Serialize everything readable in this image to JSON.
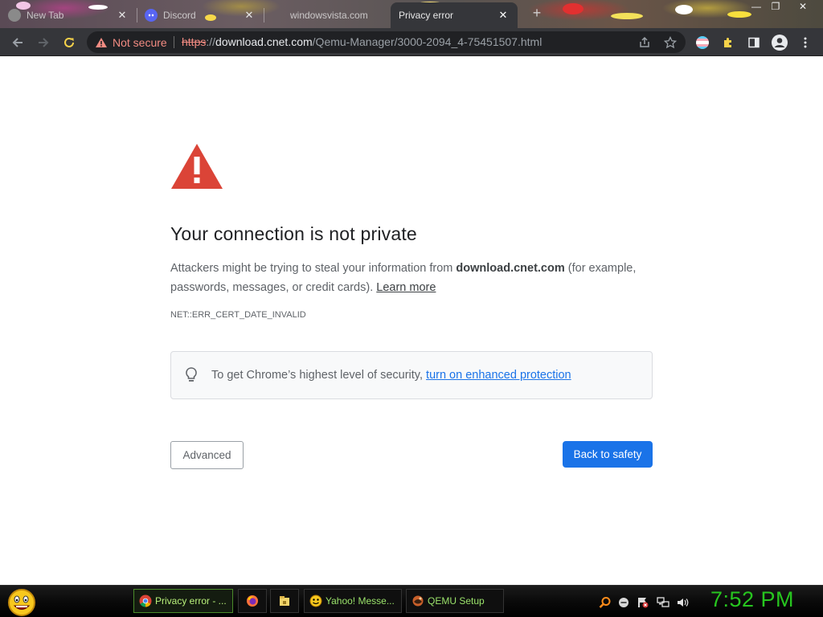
{
  "browser": {
    "tabs": [
      {
        "title": "New Tab",
        "favicon": "new-tab-favicon-icon"
      },
      {
        "title": "Discord",
        "favicon": "discord-icon"
      },
      {
        "title": "windowsvista.com",
        "favicon": "globe-icon"
      },
      {
        "title": "Privacy error",
        "favicon": "warning-icon",
        "active": true
      }
    ],
    "tab_close_glyph": "✕",
    "new_tab_glyph": "+",
    "window_controls": [
      "—",
      "❐",
      "✕"
    ],
    "security_label": "Not secure",
    "url": {
      "scheme": "https",
      "separator": "://",
      "host": "download.cnet.com",
      "path": "/Qemu-Manager/3000-2094_4-75451507.html"
    }
  },
  "page": {
    "heading": "Your connection is not private",
    "paragraph_prefix": "Attackers might be trying to steal your information from ",
    "paragraph_host": "download.cnet.com",
    "paragraph_suffix": " (for example, passwords, messages, or credit cards). ",
    "learn_more": "Learn more",
    "error_code": "NET::ERR_CERT_DATE_INVALID",
    "enhanced_prefix": "To get Chrome’s highest level of security, ",
    "enhanced_link": "turn on enhanced protection",
    "advanced_label": "Advanced",
    "back_label": "Back to safety"
  },
  "taskbar": {
    "tasks": [
      {
        "label": "Privacy error - ...",
        "icon": "chrome-icon",
        "active": true
      },
      {
        "label": "Yahoo! Messe...",
        "icon": "yahoo-messenger-icon"
      },
      {
        "label": "QEMU Setup",
        "icon": "qemu-icon"
      }
    ],
    "clock": "7:52 PM"
  },
  "colors": {
    "toolbar": "#35363a",
    "omnibox": "#202124",
    "warning_red": "#f28b82",
    "big_warning_red": "#db4437",
    "primary_blue": "#1a73e8",
    "clock_green": "#27c61f"
  }
}
